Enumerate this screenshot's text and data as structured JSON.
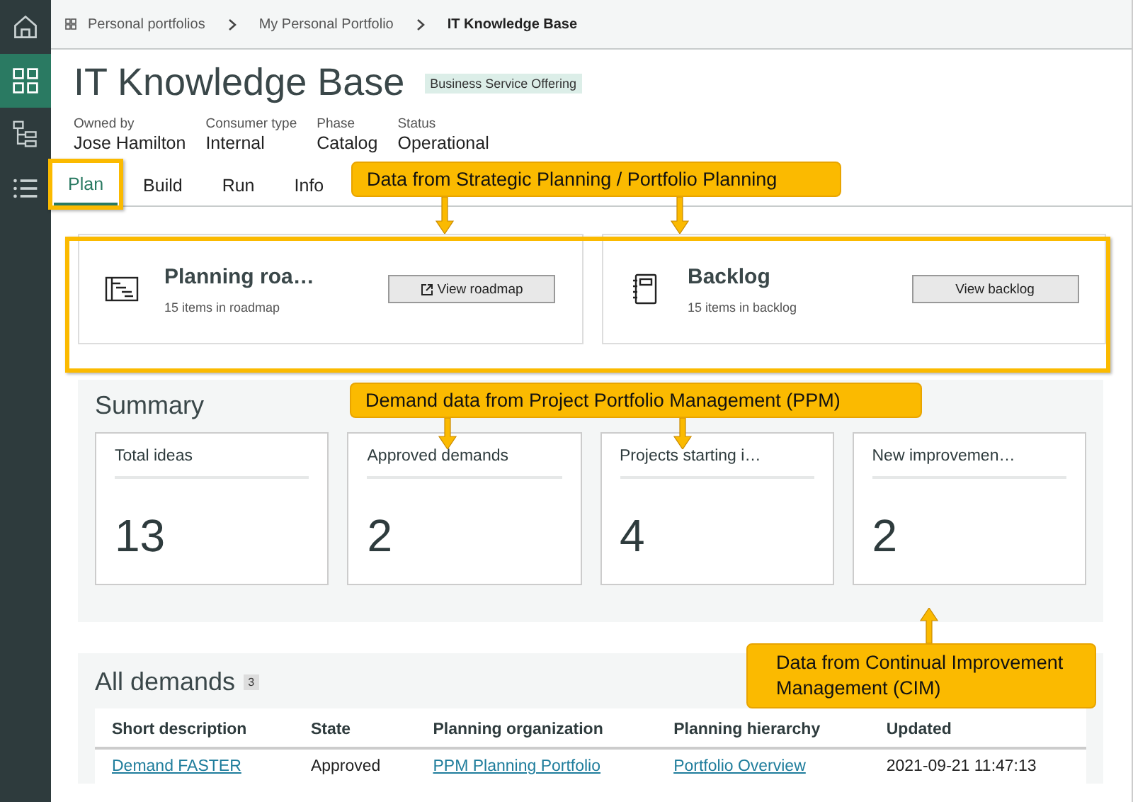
{
  "sidebar": {
    "items": [
      {
        "kind": "home",
        "selected": false
      },
      {
        "kind": "grid",
        "selected": true
      },
      {
        "kind": "tree",
        "selected": false
      },
      {
        "kind": "list",
        "selected": false
      }
    ]
  },
  "breadcrumbs": [
    "Personal portfolios",
    "My Personal Portfolio",
    "IT Knowledge Base"
  ],
  "header": {
    "title": "IT Knowledge Base",
    "badge": "Business Service Offering",
    "fields": [
      {
        "label": "Owned by",
        "value": "Jose Hamilton"
      },
      {
        "label": "Consumer type",
        "value": "Internal"
      },
      {
        "label": "Phase",
        "value": "Catalog"
      },
      {
        "label": "Status",
        "value": "Operational"
      }
    ]
  },
  "tabs": [
    {
      "label": "Plan",
      "selected": true
    },
    {
      "label": "Build",
      "selected": false
    },
    {
      "label": "Run",
      "selected": false
    },
    {
      "label": "Info",
      "selected": false
    }
  ],
  "cards": [
    {
      "kind": "roadmap",
      "title": "Planning roa…",
      "subtitle": "15 items in roadmap",
      "button": "View roadmap"
    },
    {
      "kind": "backlog",
      "title": "Backlog",
      "subtitle": "15 items in backlog",
      "button": "View backlog"
    }
  ],
  "summary": {
    "title": "Summary",
    "tiles": [
      {
        "label": "Total ideas",
        "value": "13"
      },
      {
        "label": "Approved demands",
        "value": "2"
      },
      {
        "label": "Projects starting i…",
        "value": "4"
      },
      {
        "label": "New improvemen…",
        "value": "2"
      }
    ]
  },
  "demands": {
    "title": "All demands",
    "count": "3",
    "columns": [
      "Short description",
      "State",
      "Planning organization",
      "Planning hierarchy",
      "Updated"
    ],
    "rows": [
      [
        "Demand FASTER",
        "Approved",
        "PPM Planning Portfolio",
        "Portfolio Overview",
        "2021-09-21 11:47:13"
      ]
    ]
  },
  "annotations": [
    "Data from Strategic Planning / Portfolio Planning",
    "Demand data from Project Portfolio Management (PPM)",
    "Data from Continual Improvement Management (CIM)"
  ]
}
